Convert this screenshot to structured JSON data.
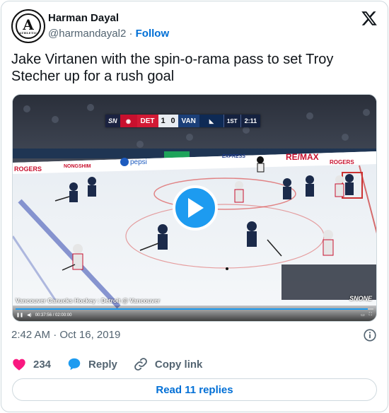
{
  "author": {
    "display_name": "Harman Dayal",
    "handle": "@harmandayal2",
    "separator": "·",
    "follow_label": "Follow",
    "avatar_letter": "A",
    "avatar_text": "ATHLETIC"
  },
  "tweet": {
    "text": "Jake Virtanen with the spin-o-rama pass to set Troy Stecher up for a rush goal",
    "time": "2:42 AM",
    "separator": "·",
    "date": "Oct 16, 2019"
  },
  "video": {
    "scorebug": {
      "network": "SN",
      "team1": "DET",
      "score1": "1",
      "score2": "0",
      "team2": "VAN",
      "period": "1ST",
      "clock": "2:11"
    },
    "caption": "Vancouver Canucks Hockey : Detroit @ Vancouver",
    "network_tag": "SNONE",
    "boards": {
      "left": "ROGERS",
      "ad1": "NONGSHIM",
      "ad2": "pepsi",
      "ad3": "EXPRESS",
      "ad4": "RE/MAX",
      "right": "ROGERS"
    },
    "time_readout": "00:37:56 / 02:00:00",
    "progress_fraction": 0.985,
    "play_icon": "play-icon"
  },
  "actions": {
    "like_count": "234",
    "reply_label": "Reply",
    "copy_label": "Copy link"
  },
  "replies_button": "Read 11 replies",
  "colors": {
    "accent": "#1d9bf0",
    "link": "#006fd6",
    "heart": "#f91880",
    "muted": "#536471"
  }
}
